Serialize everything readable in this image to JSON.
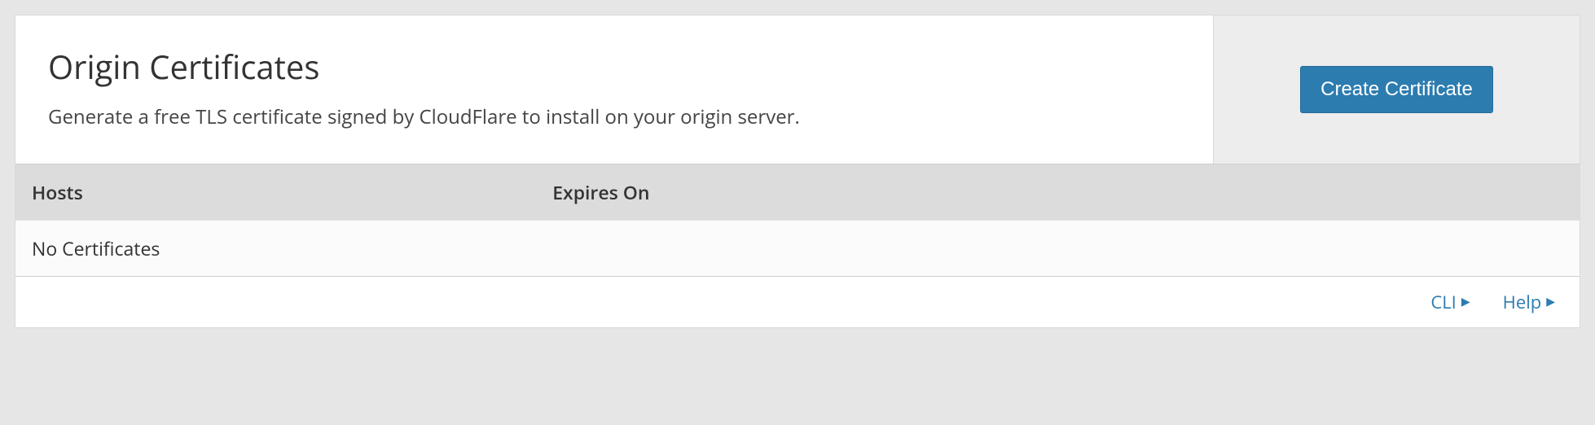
{
  "header": {
    "title": "Origin Certificates",
    "description": "Generate a free TLS certificate signed by CloudFlare to install on your origin server.",
    "create_button_label": "Create Certificate"
  },
  "table": {
    "columns": {
      "hosts": "Hosts",
      "expires": "Expires On"
    },
    "empty_message": "No Certificates"
  },
  "footer": {
    "cli_label": "CLI",
    "help_label": "Help"
  }
}
